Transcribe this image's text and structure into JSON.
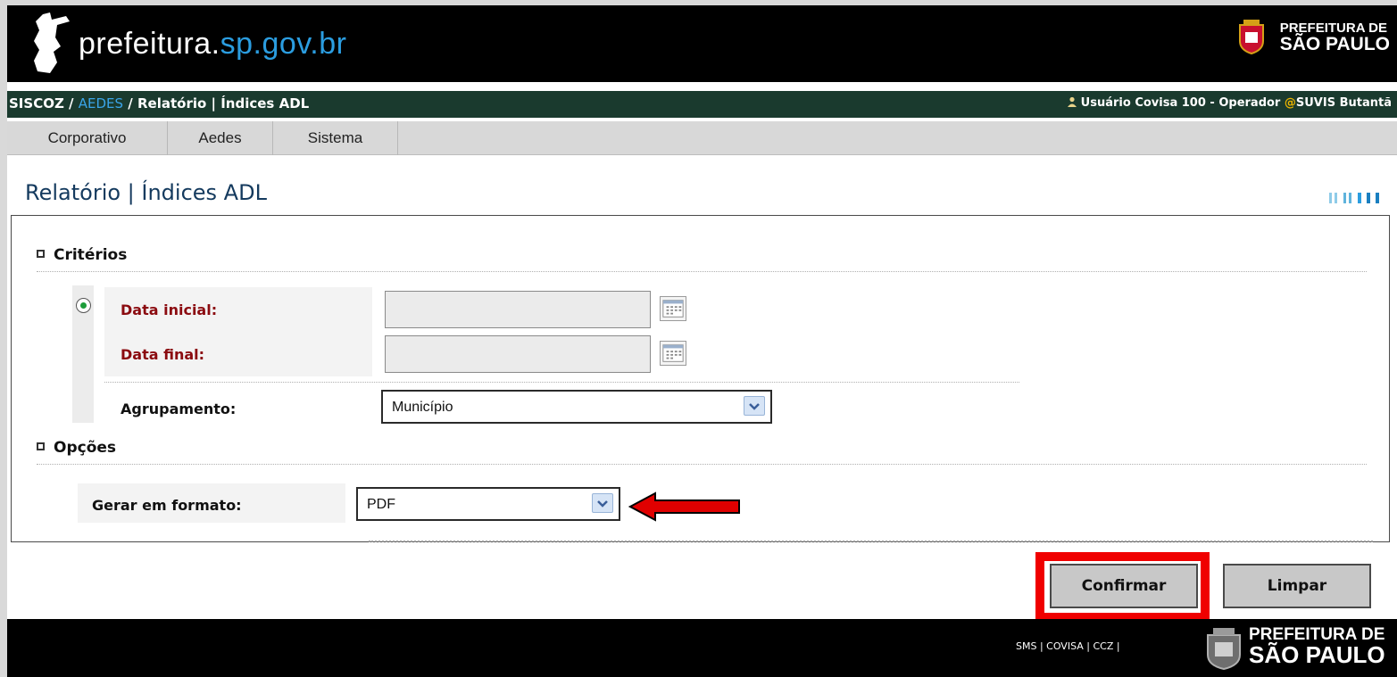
{
  "header": {
    "site_title_main": "prefeitura.",
    "site_title_accent": "sp.gov.br",
    "brand_line1": "PREFEITURA DE",
    "brand_line2": "SÃO PAULO"
  },
  "breadcrumb": {
    "system": "SISCOZ",
    "sep1": " / ",
    "module": "AEDES",
    "sep2": " / ",
    "page": "Relatório | Índices ADL"
  },
  "user": {
    "icon": "user-icon",
    "name": "Usuário Covisa 100 - Operador",
    "at_symbol": "@",
    "unit": "SUVIS Butantã"
  },
  "menu": {
    "items": [
      {
        "label": "Corporativo"
      },
      {
        "label": "Aedes"
      },
      {
        "label": "Sistema"
      }
    ]
  },
  "page": {
    "title": "Relatório | Índices ADL"
  },
  "criterios": {
    "heading": "Critérios",
    "data_inicial_label": "Data inicial:",
    "data_inicial_value": "",
    "data_final_label": "Data final:",
    "data_final_value": "",
    "agrupamento_label": "Agrupamento:",
    "agrupamento_value": "Município"
  },
  "opcoes": {
    "heading": "Opções",
    "formato_label": "Gerar em formato:",
    "formato_value": "PDF"
  },
  "buttons": {
    "confirm": "Confirmar",
    "clear": "Limpar"
  },
  "footer": {
    "links": "SMS | COVISA | CCZ |",
    "brand_line1": "PREFEITURA DE",
    "brand_line2": "SÃO PAULO"
  },
  "colors": {
    "header_bg": "#000000",
    "breadcrumb_bg": "#1a3a2e",
    "accent_blue": "#2b9de0",
    "title_blue": "#143a5e",
    "required_red": "#8b0b10",
    "annotation_red": "#f00000"
  }
}
